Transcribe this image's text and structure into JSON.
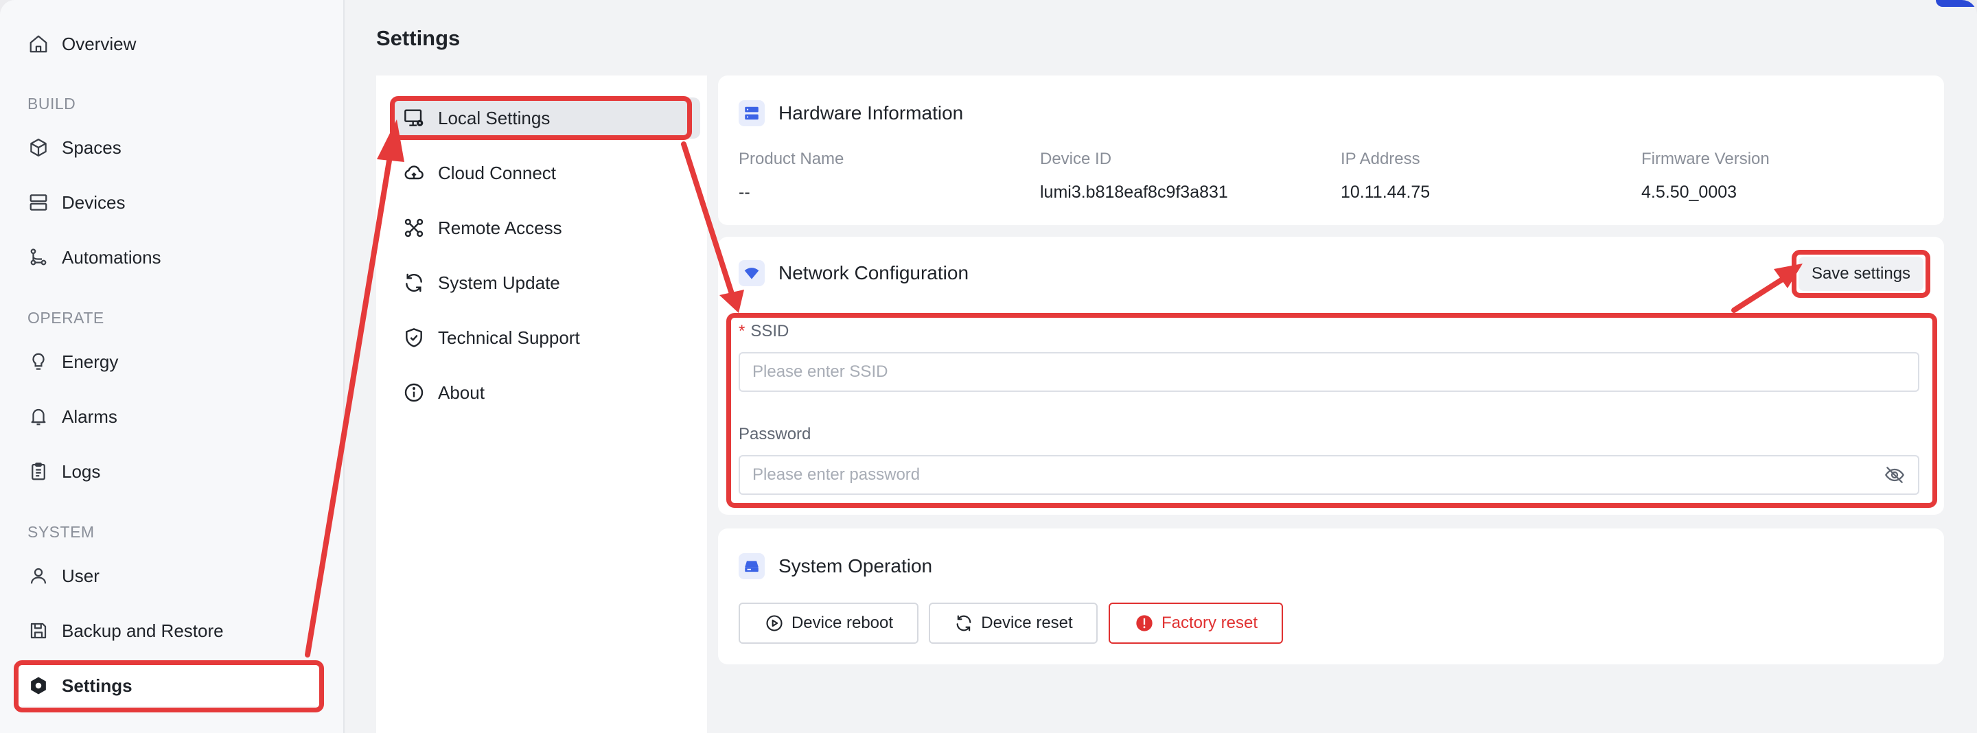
{
  "sidebar": {
    "sections": {
      "build": "BUILD",
      "operate": "OPERATE",
      "system": "SYSTEM"
    },
    "items": [
      {
        "label": "Overview",
        "icon": "home-icon"
      },
      {
        "label": "Spaces",
        "icon": "cube-icon"
      },
      {
        "label": "Devices",
        "icon": "server-icon"
      },
      {
        "label": "Automations",
        "icon": "flow-icon"
      },
      {
        "label": "Energy",
        "icon": "bulb-icon"
      },
      {
        "label": "Alarms",
        "icon": "bell-icon"
      },
      {
        "label": "Logs",
        "icon": "clipboard-icon"
      },
      {
        "label": "User",
        "icon": "user-icon"
      },
      {
        "label": "Backup and Restore",
        "icon": "save-icon"
      },
      {
        "label": "Settings",
        "icon": "settings-icon",
        "active": true
      }
    ]
  },
  "page": {
    "title": "Settings"
  },
  "subnav": {
    "items": [
      {
        "label": "Local Settings",
        "icon": "monitor-gear-icon",
        "active": true
      },
      {
        "label": "Cloud Connect",
        "icon": "cloud-icon"
      },
      {
        "label": "Remote Access",
        "icon": "remote-icon"
      },
      {
        "label": "System Update",
        "icon": "refresh-icon"
      },
      {
        "label": "Technical Support",
        "icon": "shield-check-icon"
      },
      {
        "label": "About",
        "icon": "info-icon"
      }
    ]
  },
  "hardware": {
    "title": "Hardware Information",
    "fields": [
      {
        "label": "Product Name",
        "value": "--"
      },
      {
        "label": "Device ID",
        "value": "lumi3.b818eaf8c9f3a831"
      },
      {
        "label": "IP Address",
        "value": "10.11.44.75"
      },
      {
        "label": "Firmware Version",
        "value": "4.5.50_0003"
      }
    ]
  },
  "network": {
    "title": "Network Configuration",
    "save_label": "Save settings",
    "ssid_required_mark": "*",
    "ssid_label": "SSID",
    "ssid_placeholder": "Please enter SSID",
    "password_label": "Password",
    "password_placeholder": "Please enter password"
  },
  "operation": {
    "title": "System Operation",
    "buttons": [
      {
        "label": "Device reboot",
        "icon": "play-circle-icon"
      },
      {
        "label": "Device reset",
        "icon": "refresh-icon"
      },
      {
        "label": "Factory reset",
        "icon": "alert-icon",
        "style": "danger"
      }
    ]
  },
  "colors": {
    "accent": "#2b4ad6",
    "danger": "#e03131",
    "annotation": "#e53a3a"
  }
}
